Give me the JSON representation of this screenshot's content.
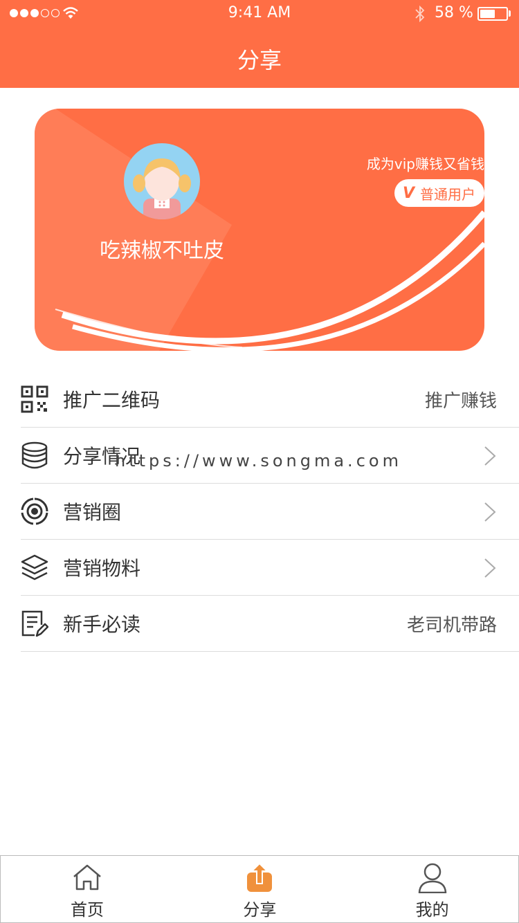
{
  "status_bar": {
    "time": "9:41 AM",
    "battery_percent": "58 %",
    "battery_level": 0.58
  },
  "header": {
    "title": "分享"
  },
  "card": {
    "username": "吃辣椒不吐皮",
    "vip_promo": "成为vip赚钱又省钱",
    "member_badge": {
      "icon": "V",
      "label": "普通用户"
    }
  },
  "menu": [
    {
      "icon": "qr-code-icon",
      "label": "推广二维码",
      "right_text": "推广赚钱",
      "chevron": false
    },
    {
      "icon": "database-icon",
      "label": "分享情况",
      "right_text": "",
      "chevron": true
    },
    {
      "icon": "target-icon",
      "label": "营销圈",
      "right_text": "",
      "chevron": true
    },
    {
      "icon": "layers-icon",
      "label": "营销物料",
      "right_text": "",
      "chevron": true
    },
    {
      "icon": "document-edit-icon",
      "label": "新手必读",
      "right_text": "老司机带路",
      "chevron": false
    }
  ],
  "watermark": "https://www.songma.com",
  "tabbar": [
    {
      "icon": "home-icon",
      "label": "首页",
      "active": false
    },
    {
      "icon": "share-upload-icon",
      "label": "分享",
      "active": true
    },
    {
      "icon": "user-icon",
      "label": "我的",
      "active": false
    }
  ],
  "colors": {
    "primary": "#ff6e45",
    "active_tab_icon": "#f0913c"
  }
}
